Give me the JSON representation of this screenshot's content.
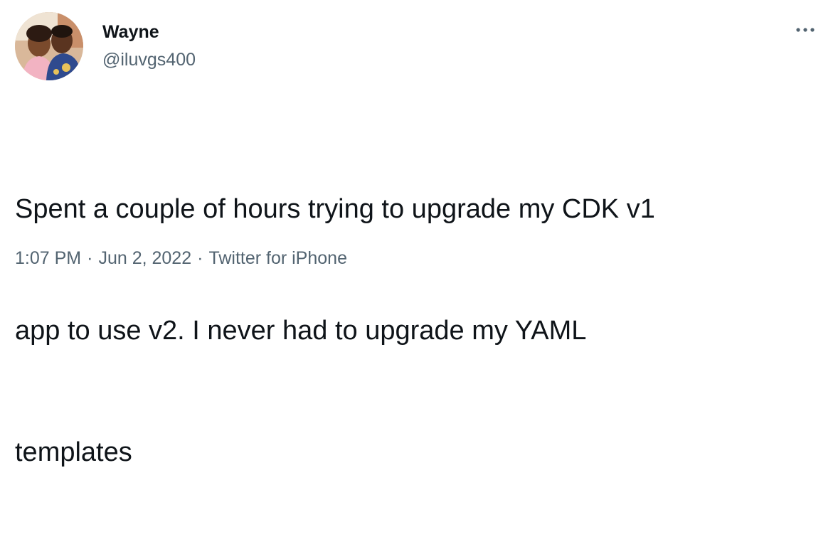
{
  "author": {
    "display_name": "Wayne",
    "handle": "@iluvgs400"
  },
  "more_menu": {
    "icon": "more-horizontal-icon"
  },
  "tweet": {
    "lines": [
      "Spent a couple of hours trying to upgrade my CDK v1",
      "app to use v2. I never had to upgrade my YAML",
      "templates"
    ]
  },
  "meta": {
    "time": "1:07 PM",
    "separator": "·",
    "date": "Jun 2, 2022",
    "source": "Twitter for iPhone"
  },
  "colors": {
    "text_primary": "#0f1419",
    "text_secondary": "#536471",
    "background": "#ffffff"
  }
}
